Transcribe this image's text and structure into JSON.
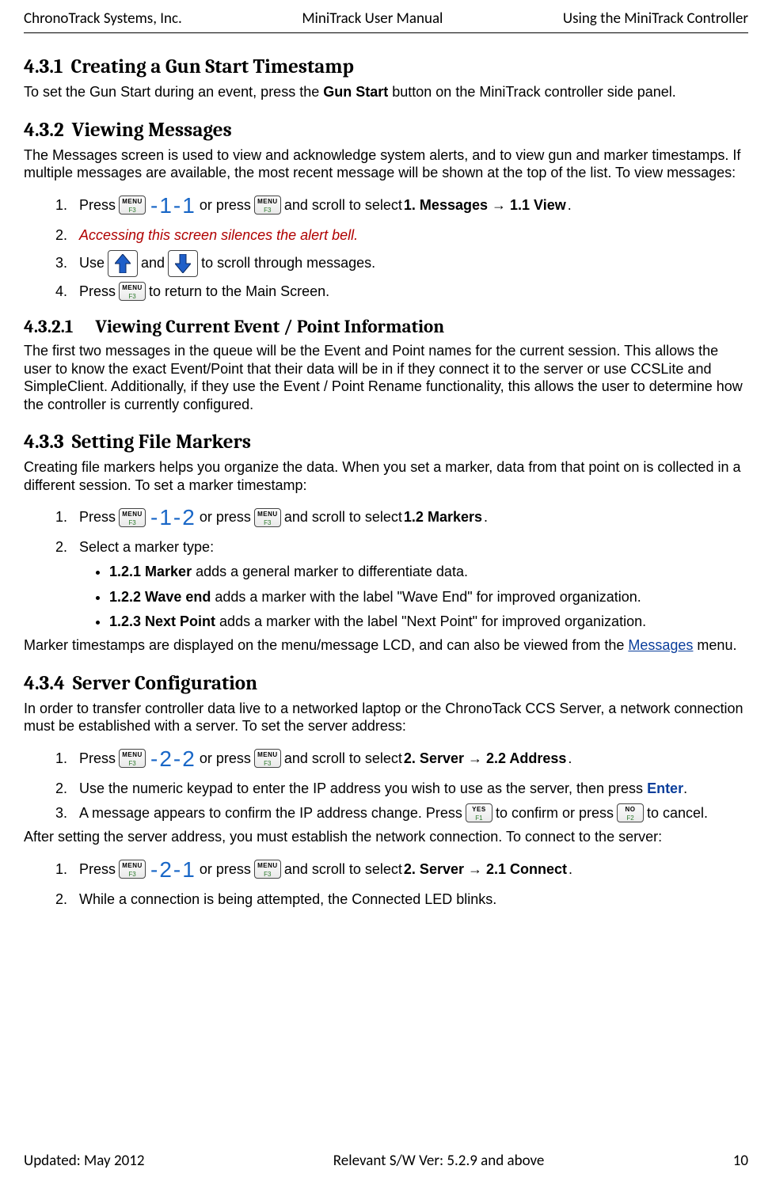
{
  "header": {
    "left": "ChronoTrack Systems, Inc.",
    "center": "MiniTrack User Manual",
    "right": "Using the MiniTrack Controller"
  },
  "footer": {
    "left": "Updated: May 2012",
    "center": "Relevant S/W Ver: 5.2.9 and above",
    "right": "10"
  },
  "keys": {
    "menu_top": "MENU",
    "menu_sub": "F3",
    "yes_top": "YES",
    "yes_sub": "F1",
    "no_top": "NO",
    "no_sub": "F2"
  },
  "codes": {
    "c11": "-1-1",
    "c12": "-1-2",
    "c22": "-2-2",
    "c21": "-2-1"
  },
  "s431": {
    "num": "4.3.1",
    "title": "Creating a Gun Start Timestamp",
    "p1a": "To set the Gun Start during an event, press the ",
    "p1b": "Gun Start",
    "p1c": " button on the MiniTrack controller side panel."
  },
  "s432": {
    "num": "4.3.2",
    "title": "Viewing Messages",
    "p1": "The Messages screen is used to view and acknowledge system alerts, and to view gun and marker timestamps. If multiple messages are available, the most recent message will be shown at the top of the list. To view messages:",
    "step1_a": " Press ",
    "step1_b": " or press ",
    "step1_c": " and scroll to select ",
    "step1_d": "1. Messages → 1.1 View",
    "step1_e": ".",
    "step2": "Accessing this screen silences the alert bell.",
    "step3_a": "Use ",
    "step3_b": " and  ",
    "step3_c": " to scroll through messages.",
    "step4_a": "Press ",
    "step4_b": " to return to the Main Screen."
  },
  "s4321": {
    "num": "4.3.2.1",
    "title": "Viewing Current Event / Point Information",
    "p1": "The first two messages in the queue will be the Event and Point names for the current session.  This allows the user to know the exact Event/Point that their data will be in if they connect it to the server or use CCSLite and SimpleClient.  Additionally, if they use the Event / Point Rename functionality, this allows the user to determine how the controller is currently configured."
  },
  "s433": {
    "num": "4.3.3",
    "title": "Setting File Markers",
    "p1": "Creating file markers helps you organize the data.  When you set a marker, data from that point on is collected in a different session. To set a marker timestamp:",
    "step1_a": "Press ",
    "step1_b": " or press ",
    "step1_c": " and scroll to select ",
    "step1_d": "1.2 Markers",
    "step1_e": ".",
    "step2": "Select a marker type:",
    "b1_bold": "1.2.1 Marker",
    "b1_rest": " adds a general marker to differentiate data.",
    "b2_bold": "1.2.2 Wave end",
    "b2_rest": " adds a marker with the label \"Wave End\" for improved organization.",
    "b3_bold": "1.2.3 Next Point",
    "b3_rest": " adds a marker with the label \"Next Point\" for improved organization.",
    "p2_a": "Marker timestamps are displayed on the menu/message LCD, and can also be viewed from the ",
    "p2_link": "Messages",
    "p2_b": " menu."
  },
  "s434": {
    "num": "4.3.4",
    "title": "Server Configuration",
    "p1": "In order to transfer controller data live to a networked laptop or the ChronoTack CCS Server, a network connection must be established with a server. To set the server address:",
    "step1_a": "Press ",
    "step1_b": " or press ",
    "step1_c": " and scroll to select ",
    "step1_d": "2. Server → 2.2 Address",
    "step1_e": ".",
    "step2_a": "Use the numeric keypad to enter the IP address you wish to use as the server, then press ",
    "step2_enter": "Enter",
    "step2_b": ".",
    "step3_a": "A message appears to confirm the IP address change.  Press ",
    "step3_b": " to confirm or press ",
    "step3_c": " to cancel.",
    "p2": "After setting the server address, you must establish the network connection.   To connect to the server:",
    "step4_a": "Press ",
    "step4_b": " or press ",
    "step4_c": " and scroll to select ",
    "step4_d": "2. Server → 2.1 Connect",
    "step4_e": ".",
    "step5": "While a connection is being attempted, the Connected LED blinks."
  }
}
